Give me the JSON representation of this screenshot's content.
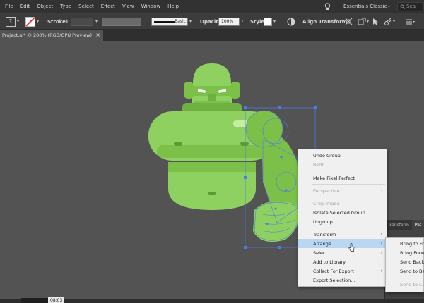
{
  "menubar": {
    "items": [
      "File",
      "Edit",
      "Object",
      "Type",
      "Select",
      "Effect",
      "View",
      "Window",
      "Help"
    ],
    "workspace": "Essentials Classic",
    "search_placeholder": "Sea"
  },
  "controlbar": {
    "stroke_label": "Stroke:",
    "brush_label": "Basic",
    "opacity_label": "Opacity:",
    "opacity_value": "100%",
    "style_label": "Style:",
    "align_label": "Align",
    "transform_label": "Transform"
  },
  "tabbar": {
    "document_title": "Project.ai* @ 200% (RGB/GPU Preview)"
  },
  "panel": {
    "tabs": [
      "Transform",
      "Pat"
    ]
  },
  "context_menu": {
    "items": [
      {
        "label": "Undo Group",
        "disabled": false,
        "submenu": false
      },
      {
        "label": "Redo",
        "disabled": true,
        "submenu": false
      },
      {
        "label": "Make Pixel Perfect",
        "disabled": false,
        "submenu": false
      },
      {
        "label": "Perspective",
        "disabled": true,
        "submenu": true
      },
      {
        "label": "Crop Image",
        "disabled": true,
        "submenu": false
      },
      {
        "label": "Isolate Selected Group",
        "disabled": false,
        "submenu": false
      },
      {
        "label": "Ungroup",
        "disabled": false,
        "submenu": false
      },
      {
        "label": "Transform",
        "disabled": false,
        "submenu": true
      },
      {
        "label": "Arrange",
        "disabled": false,
        "submenu": true,
        "highlighted": true
      },
      {
        "label": "Select",
        "disabled": false,
        "submenu": true
      },
      {
        "label": "Add to Library",
        "disabled": false,
        "submenu": false
      },
      {
        "label": "Collect For Export",
        "disabled": false,
        "submenu": true
      },
      {
        "label": "Export Selection...",
        "disabled": false,
        "submenu": false
      }
    ]
  },
  "arrange_submenu": {
    "items": [
      {
        "label": "Bring to Fr",
        "disabled": false
      },
      {
        "label": "Bring Forw",
        "disabled": false
      },
      {
        "label": "Send Back",
        "disabled": false
      },
      {
        "label": "Send to Ba",
        "disabled": false
      },
      {
        "label": "Send to Cu",
        "disabled": true
      }
    ]
  },
  "statusbar": {
    "timecode": "08:03"
  },
  "colors": {
    "ui_dark": "#323232",
    "canvas": "#535353",
    "ogre_light": "#8fd160",
    "ogre_mid": "#7cc04a",
    "ogre_dark": "#5e9a35",
    "selection": "#4a7be8",
    "menu_highlight": "#b9d6f3"
  }
}
